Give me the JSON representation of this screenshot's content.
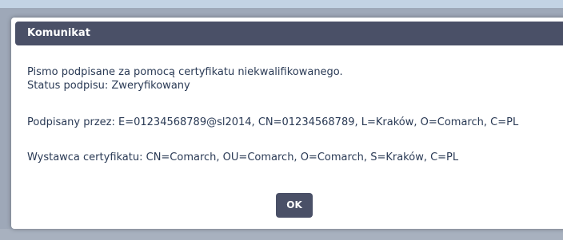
{
  "dialog": {
    "title": "Komunikat",
    "lines": [
      "Pismo podpisane za pomocą certyfikatu niekwalifikowanego.",
      "Status podpisu: Zweryfikowany",
      "Podpisany przez: E=01234568789@sl2014, CN=01234568789, L=Kraków, O=Comarch, C=PL",
      "Wystawca certyfikatu: CN=Comarch, OU=Comarch, O=Comarch, S=Kraków, C=PL"
    ],
    "ok_label": "OK"
  },
  "colors": {
    "titlebar": "#4a5067",
    "text": "#2a3a55",
    "overlay": "#9ea8b8"
  }
}
